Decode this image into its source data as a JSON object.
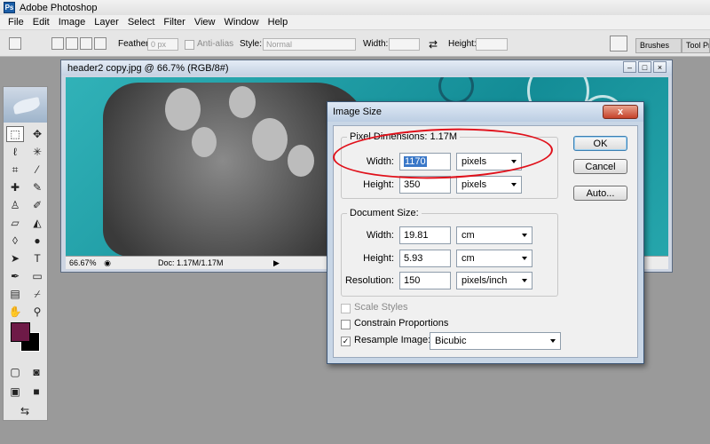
{
  "app": {
    "title": "Adobe Photoshop",
    "logo_text": "Ps"
  },
  "menu": [
    "File",
    "Edit",
    "Image",
    "Layer",
    "Select",
    "Filter",
    "View",
    "Window",
    "Help"
  ],
  "options_bar": {
    "feather_label": "Feather:",
    "feather_value": "0 px",
    "antialias_label": "Anti-alias",
    "style_label": "Style:",
    "style_value": "Normal",
    "width_label": "Width:",
    "height_label": "Height:"
  },
  "panels": {
    "tab1": "Brushes",
    "tab2": "Tool Pr"
  },
  "document": {
    "title": "header2 copy.jpg @ 66.7% (RGB/8#)",
    "zoom": "66.67%",
    "doc_size": "Doc: 1.17M/1.17M"
  },
  "dialog": {
    "title": "Image Size",
    "close_label": "x",
    "pixel_dimensions_label": "Pixel Dimensions:",
    "pixel_dimensions_value": "1.17M",
    "width_label": "Width:",
    "width_value": "1170",
    "width_unit": "pixels",
    "height_label": "Height:",
    "height_value": "350",
    "height_unit": "pixels",
    "document_size_label": "Document Size:",
    "doc_width_label": "Width:",
    "doc_width_value": "19.81",
    "doc_width_unit": "cm",
    "doc_height_label": "Height:",
    "doc_height_value": "5.93",
    "doc_height_unit": "cm",
    "resolution_label": "Resolution:",
    "resolution_value": "150",
    "resolution_unit": "pixels/inch",
    "scale_styles_label": "Scale Styles",
    "constrain_label": "Constrain Proportions",
    "resample_label": "Resample Image:",
    "resample_value": "Bicubic",
    "ok_label": "OK",
    "cancel_label": "Cancel",
    "auto_label": "Auto...",
    "resample_checked": "✓"
  },
  "colors": {
    "foreground": "#6e1a47",
    "background": "#000000",
    "highlight": "#e0101a"
  }
}
